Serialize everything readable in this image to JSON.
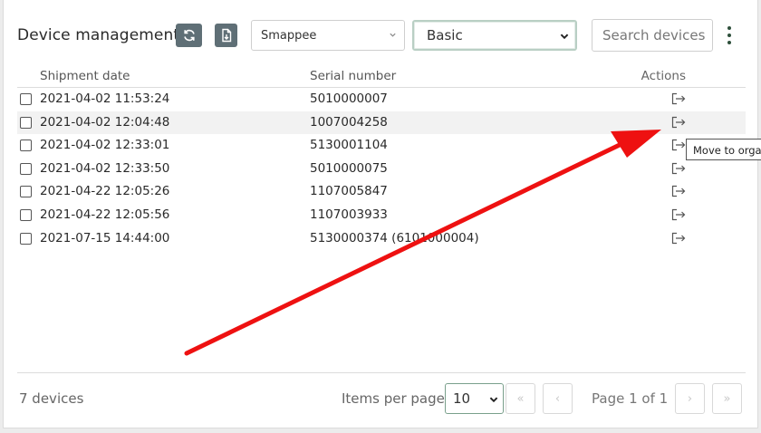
{
  "header": {
    "title": "Device management",
    "refresh_icon": "refresh-icon",
    "export_icon": "export-file-icon",
    "brand_select": "Smappee",
    "view_select": "Basic",
    "search_placeholder": "Search devices",
    "menu_icon": "kebab-menu-icon"
  },
  "table": {
    "columns": [
      "Shipment date",
      "Serial number",
      "Actions"
    ],
    "rows": [
      {
        "date": "2021-04-02 11:53:24",
        "serial": "5010000007",
        "action_icon": "move-to-organization-icon"
      },
      {
        "date": "2021-04-02 12:04:48",
        "serial": "1007004258",
        "action_icon": "move-to-organization-icon"
      },
      {
        "date": "2021-04-02 12:33:01",
        "serial": "5130001104",
        "action_icon": "move-to-organization-icon"
      },
      {
        "date": "2021-04-02 12:33:50",
        "serial": "5010000075",
        "action_icon": "move-to-organization-icon"
      },
      {
        "date": "2021-04-22 12:05:26",
        "serial": "1107005847",
        "action_icon": "move-to-organization-icon"
      },
      {
        "date": "2021-04-22 12:05:56",
        "serial": "1107003933",
        "action_icon": "move-to-organization-icon"
      },
      {
        "date": "2021-07-15 14:44:00",
        "serial": "5130000374 (6101000004)",
        "action_icon": "move-to-organization-icon"
      }
    ]
  },
  "tooltip": "Move to organization",
  "footer": {
    "count": "7 devices",
    "items_per_page_label": "Items per page",
    "items_per_page": "10",
    "page_info": "Page 1 of 1",
    "first_label": "«",
    "prev_label": "‹",
    "next_label": "›",
    "last_label": "»"
  },
  "colors": {
    "icon_button": "#5f6f76",
    "accent_green": "#2e4f3b",
    "annotation_arrow": "#ee1111"
  }
}
